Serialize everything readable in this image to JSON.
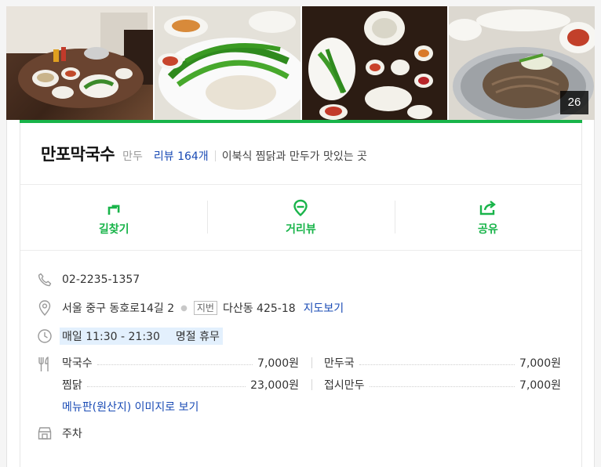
{
  "photos": {
    "count": "26"
  },
  "place": {
    "name": "만포막국수",
    "category": "만두",
    "review": "리뷰 164개",
    "description": "이북식 찜닭과 만두가 맛있는 곳"
  },
  "actions": [
    {
      "label": "길찾기",
      "icon": "directions-icon"
    },
    {
      "label": "거리뷰",
      "icon": "streetview-icon"
    },
    {
      "label": "공유",
      "icon": "share-icon"
    }
  ],
  "info": {
    "phone": "02-2235-1357",
    "address": "서울 중구 동호로14길 2",
    "jibun_label": "지번",
    "jibun": "다산동 425-18",
    "map_link": "지도보기",
    "hours": "매일 11:30 - 21:30",
    "hours_note": "명절 휴무",
    "menu": [
      {
        "name": "막국수",
        "price": "7,000원"
      },
      {
        "name": "만두국",
        "price": "7,000원"
      },
      {
        "name": "찜닭",
        "price": "23,000원"
      },
      {
        "name": "접시만두",
        "price": "7,000원"
      }
    ],
    "menu_link": "메뉴판(원산지) 이미지로 보기",
    "parking": "주차"
  },
  "colors": {
    "accent": "#19b44a",
    "link": "#1a4bb5"
  }
}
